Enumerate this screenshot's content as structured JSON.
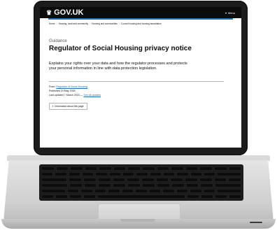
{
  "header": {
    "brand": "GOV.UK",
    "crown_icon": "crown-icon",
    "menu_label": "Menu"
  },
  "breadcrumb": [
    "Home",
    "Housing, local and community",
    "Housing and communities",
    "Council housing and housing association"
  ],
  "document": {
    "caption": "Guidance",
    "title": "Regulator of Social Housing privacy notice",
    "summary": "Explains your rights over your data and how the regulator processes and protects your personal information in line with data protection legislation."
  },
  "meta": {
    "from_label": "From:",
    "from_value": "Regulator of Social Housing",
    "published": "Published 24 May 2018",
    "updated_label": "Last updated 7 March 2023 —",
    "updated_link": "See all updates"
  },
  "info_button": "Information about this page",
  "colors": {
    "header_bg": "#0b0c0c",
    "link": "#1d70b8",
    "accent": "#1d70b8"
  }
}
